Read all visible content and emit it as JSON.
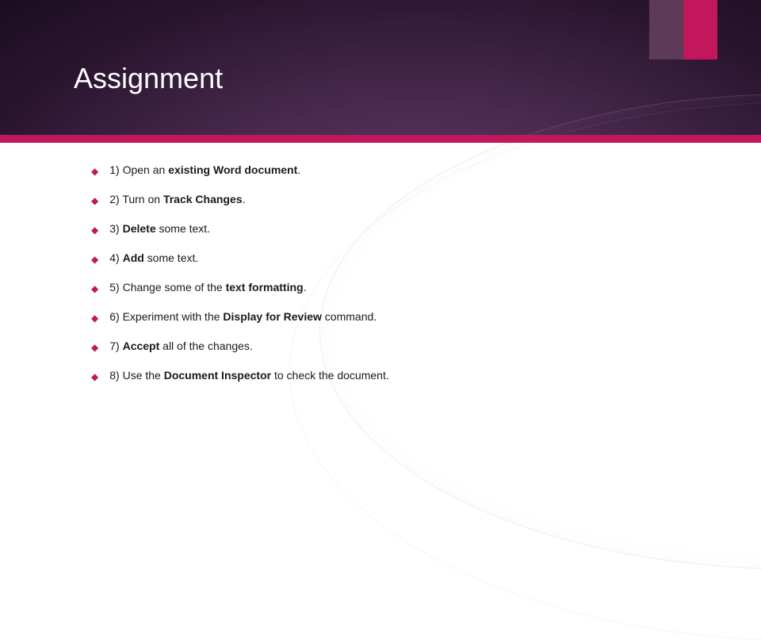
{
  "title": "Assignment",
  "items": [
    {
      "num": "1)",
      "parts": [
        {
          "t": "Open an "
        },
        {
          "t": "existing Word document",
          "b": true
        },
        {
          "t": "."
        }
      ]
    },
    {
      "num": "2)",
      "parts": [
        {
          "t": "Turn on "
        },
        {
          "t": "Track Changes",
          "b": true
        },
        {
          "t": "."
        }
      ]
    },
    {
      "num": "3)",
      "parts": [
        {
          "t": "Delete",
          "b": true
        },
        {
          "t": " some text."
        }
      ]
    },
    {
      "num": "4)",
      "parts": [
        {
          "t": "Add",
          "b": true
        },
        {
          "t": " some text."
        }
      ]
    },
    {
      "num": "5)",
      "parts": [
        {
          "t": "Change some of the "
        },
        {
          "t": "text formatting",
          "b": true
        },
        {
          "t": "."
        }
      ]
    },
    {
      "num": "6)",
      "parts": [
        {
          "t": "Experiment with the "
        },
        {
          "t": "Display for Review",
          "b": true
        },
        {
          "t": " command."
        }
      ]
    },
    {
      "num": "7)",
      "parts": [
        {
          "t": "Accept",
          "b": true
        },
        {
          "t": " all of the changes."
        }
      ]
    },
    {
      "num": "8)",
      "parts": [
        {
          "t": "Use the "
        },
        {
          "t": "Document Inspector",
          "b": true
        },
        {
          "t": " to check the document."
        }
      ]
    }
  ]
}
